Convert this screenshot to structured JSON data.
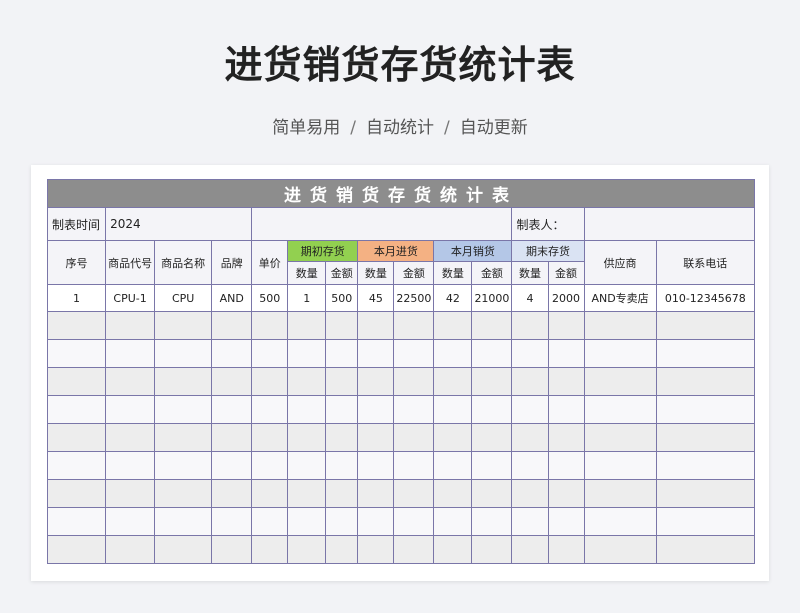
{
  "page": {
    "title": "进货销货存货统计表",
    "subtitle": [
      "简单易用",
      "自动统计",
      "自动更新"
    ],
    "separator": "/"
  },
  "sheet": {
    "banner": "进货销货存货统计表",
    "meta": {
      "time_label": "制表时间",
      "year": "2024",
      "maker_label": "制表人："
    },
    "headers": {
      "index": "序号",
      "code": "商品代号",
      "name": "商品名称",
      "brand": "品牌",
      "price": "单价",
      "groups": [
        "期初存货",
        "本月进货",
        "本月销货",
        "期末存货"
      ],
      "qty": "数量",
      "amount": "金额",
      "supplier": "供应商",
      "phone": "联系电话"
    },
    "rows": [
      [
        "1",
        "CPU-1",
        "CPU",
        "AND",
        "500",
        "1",
        "500",
        "45",
        "22500",
        "42",
        "21000",
        "4",
        "2000",
        "AND专卖店",
        "010-12345678"
      ]
    ],
    "empty_rows": 9
  },
  "colors": {
    "green": "#92d050",
    "orange": "#f4b183",
    "blue": "#b4c7e7",
    "lavender": "#dae3f3",
    "banner": "#8d8d8d",
    "grid": "#7a76a8"
  }
}
